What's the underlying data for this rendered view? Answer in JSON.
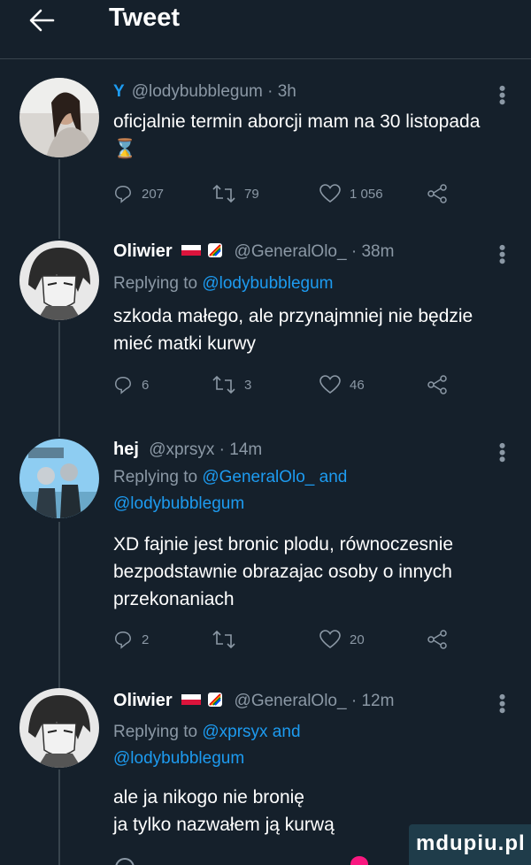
{
  "header": {
    "title": "Tweet"
  },
  "tweets": [
    {
      "handle_time": "@lodybubblegum · 3h",
      "text": "oficjalnie termin aborcji mam na 30 listopada",
      "emoji": "⌛",
      "replies": "207",
      "retweets": "79",
      "likes": "1 056"
    },
    {
      "name": "Oliwier",
      "handle_time": "@GeneralOlo_ · 38m",
      "replying_prefix": "Replying to ",
      "replying_to": "@lodybubblegum",
      "text": "szkoda małego, ale przynajmniej nie będzie mieć matki kurwy",
      "replies": "6",
      "retweets": "3",
      "likes": "46"
    },
    {
      "name": "hej",
      "handle_time": "@xprsyx · 14m",
      "replying_prefix": "Replying to ",
      "replying_to_1": "@GeneralOlo_ and",
      "replying_to_2": "@lodybubblegum",
      "text": "XD fajnie jest bronic plodu, równoczesnie bezpodstawnie obrazajac osoby o innych przekonaniach",
      "replies": "2",
      "retweets": "",
      "likes": "20"
    },
    {
      "name": "Oliwier",
      "handle_time": "@GeneralOlo_ · 12m",
      "replying_prefix": "Replying to ",
      "replying_to_1": "@xprsyx and",
      "replying_to_2": "@lodybubblegum",
      "text_line1": "ale ja nikogo nie bronię",
      "text_line2": "ja tylko nazwałem ją kurwą"
    }
  ],
  "watermark": "mdupiu.pl",
  "colors": {
    "background": "#15202b",
    "link": "#1d9bf0",
    "muted": "#8b98a5",
    "divider": "#38444d"
  }
}
